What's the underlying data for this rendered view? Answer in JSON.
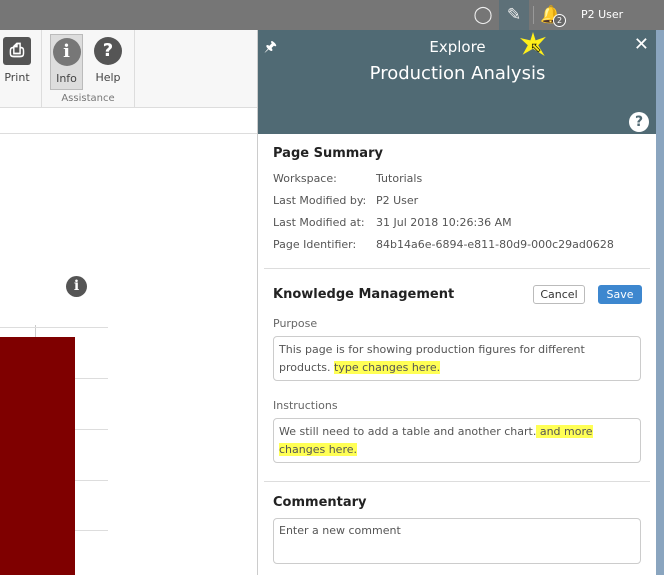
{
  "topbar": {
    "user": "P2 User",
    "notification_count": "2",
    "icons": [
      "lightbulb-icon",
      "pencil-icon",
      "bell-icon"
    ]
  },
  "ribbon": {
    "print": "Print",
    "info": "Info",
    "help": "Help",
    "group": "Assistance"
  },
  "panel": {
    "title": "Explore",
    "subtitle": "Production Analysis",
    "summary": {
      "heading": "Page Summary",
      "rows": [
        {
          "label": "Workspace:",
          "value": "Tutorials"
        },
        {
          "label": "Last Modified by:",
          "value": "P2 User"
        },
        {
          "label": "Last Modified at:",
          "value": "31 Jul 2018 10:26:36 AM"
        },
        {
          "label": "Page Identifier:",
          "value": "84b14a6e-6894-e811-80d9-000c29ad0628"
        }
      ]
    },
    "km": {
      "heading": "Knowledge Management",
      "cancel": "Cancel",
      "save": "Save",
      "purpose_label": "Purpose",
      "purpose_text": "This page is  for showing production figures for different products. ",
      "purpose_added": "type changes here.",
      "instructions_label": "Instructions",
      "instructions_text": "We still need to add a table and another chart.",
      "instructions_added": " and more changes here."
    },
    "commentary": {
      "heading": "Commentary",
      "placeholder": "Enter a new comment"
    }
  },
  "colors": {
    "panel_header": "#506a74",
    "save": "#3d87cf",
    "bar": "#7f0000",
    "highlight": "#ffff55"
  }
}
